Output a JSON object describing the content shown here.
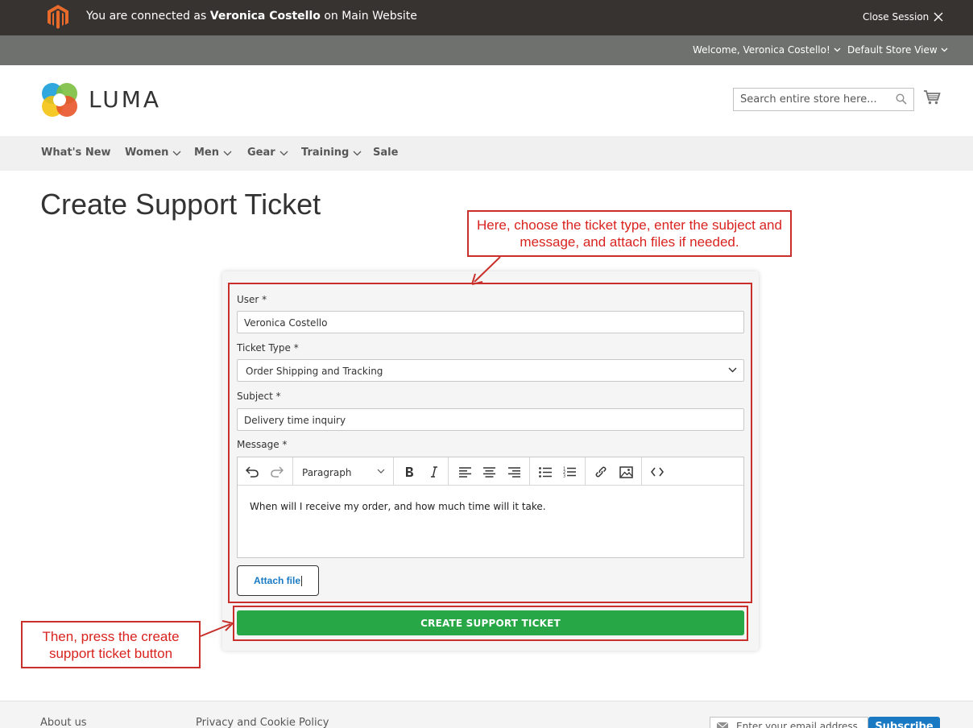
{
  "admin_bar": {
    "text_prefix": "You are connected as",
    "user_name": "Veronica Costello",
    "text_suffix": "on Main Website",
    "close_label": "Close Session"
  },
  "panel": {
    "welcome": "Welcome, Veronica Costello!",
    "store_view": "Default Store View"
  },
  "header": {
    "logo_text": "LUMA",
    "search_placeholder": "Search entire store here..."
  },
  "nav": {
    "items": [
      {
        "label": "What's New",
        "has_dropdown": false
      },
      {
        "label": "Women",
        "has_dropdown": true
      },
      {
        "label": "Men",
        "has_dropdown": true
      },
      {
        "label": "Gear",
        "has_dropdown": true
      },
      {
        "label": "Training",
        "has_dropdown": true
      },
      {
        "label": "Sale",
        "has_dropdown": false
      }
    ]
  },
  "page": {
    "title": "Create Support Ticket"
  },
  "form": {
    "user_label": "User *",
    "user_value": "Veronica Costello",
    "ticket_type_label": "Ticket Type *",
    "ticket_type_value": "Order Shipping and Tracking",
    "subject_label": "Subject *",
    "subject_value": "Delivery time inquiry",
    "message_label": "Message *",
    "paragraph_format": "Paragraph",
    "message_body": "When will I receive my order, and how much time will it take.",
    "attach_label": "Attach file",
    "submit_label": "CREATE SUPPORT TICKET"
  },
  "annotations": {
    "callout_top": "Here, choose the ticket type, enter the subject and message, and attach files if needed.",
    "callout_bottom": "Then, press the create support ticket button",
    "color": "#c9302c"
  },
  "footer": {
    "about": "About us",
    "privacy": "Privacy and Cookie Policy",
    "newsletter_placeholder": "Enter your email address",
    "subscribe_label": "Subscribe"
  },
  "colors": {
    "admin_bar": "#373330",
    "panel_header": "#6e716e",
    "primary": "#1979c3",
    "create_button": "#27a745"
  }
}
